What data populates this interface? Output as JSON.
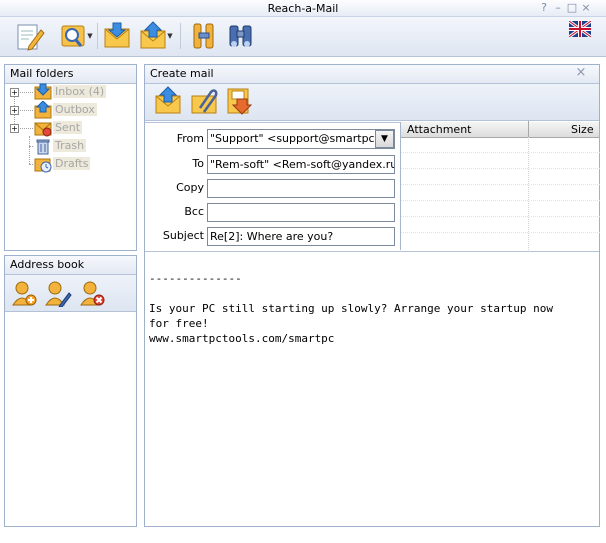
{
  "window": {
    "title": "Reach-a-Mail",
    "help": "?",
    "minimize": "–",
    "maximize": "□",
    "close": "×"
  },
  "mail_folders": {
    "title": "Mail folders",
    "items": [
      {
        "label": "Inbox (4)",
        "icon": "inbox-icon",
        "expandable": true
      },
      {
        "label": "Outbox",
        "icon": "outbox-icon",
        "expandable": true
      },
      {
        "label": "Sent",
        "icon": "sent-icon",
        "expandable": true
      },
      {
        "label": "Trash",
        "icon": "trash-icon",
        "expandable": false
      },
      {
        "label": "Drafts",
        "icon": "drafts-icon",
        "expandable": false
      }
    ]
  },
  "address_book": {
    "title": "Address book"
  },
  "create_mail": {
    "title": "Create mail",
    "close": "×",
    "fields": {
      "from_label": "From",
      "from_value": "\"Support\" <support@smartpctools",
      "to_label": "To",
      "to_value": "\"Rem-soft\" <Rem-soft@yandex.ru>",
      "copy_label": "Copy",
      "copy_value": "",
      "bcc_label": "Bcc",
      "bcc_value": "",
      "subject_label": "Subject",
      "subject_value": "Re[2]: Where are you?"
    },
    "attachments": {
      "col_name": "Attachment",
      "col_size": "Size"
    },
    "body": "--------------\n\nIs your PC still starting up slowly? Arrange your startup now\nfor free!\nwww.smartpctools.com/smartpc"
  },
  "colors": {
    "panel_border": "#9fb1cc",
    "header_bg": "#e3e9f3",
    "toolbar_bg": "#dfe6f2",
    "folder_icon": "#f3b23b"
  }
}
